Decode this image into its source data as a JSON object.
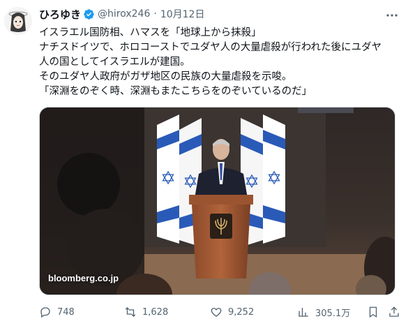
{
  "author": {
    "name": "ひろゆき",
    "handle": "@hirox246",
    "separator": "·",
    "date": "10月12日"
  },
  "tweet": {
    "lines": [
      "イスラエル国防相、ハマスを「地球上から抹殺」",
      "ナチスドイツで、ホロコーストでユダヤ人の大量虐殺が行われた後にユダヤ",
      "人の国としてイスラエルが建国。",
      "そのユダヤ人政府がガザ地区の民族の大量虐殺を示唆。",
      "「深淵をのぞく時、深淵もまたこちらをのぞいているのだ」"
    ]
  },
  "media": {
    "watermark": "bloomberg.co.jp"
  },
  "actions": {
    "replies": "748",
    "retweets": "1,628",
    "likes": "9,252",
    "views": "305.1万"
  },
  "icons": {
    "verified": "verified-badge-icon",
    "more": "more-dots-icon",
    "reply": "reply-icon",
    "retweet": "retweet-icon",
    "like": "heart-icon",
    "views": "views-chart-icon",
    "bookmark": "bookmark-icon",
    "share": "share-icon"
  },
  "colors": {
    "verified_blue": "#1d9bf0",
    "text_primary": "#0f1419",
    "text_secondary": "#536471"
  }
}
